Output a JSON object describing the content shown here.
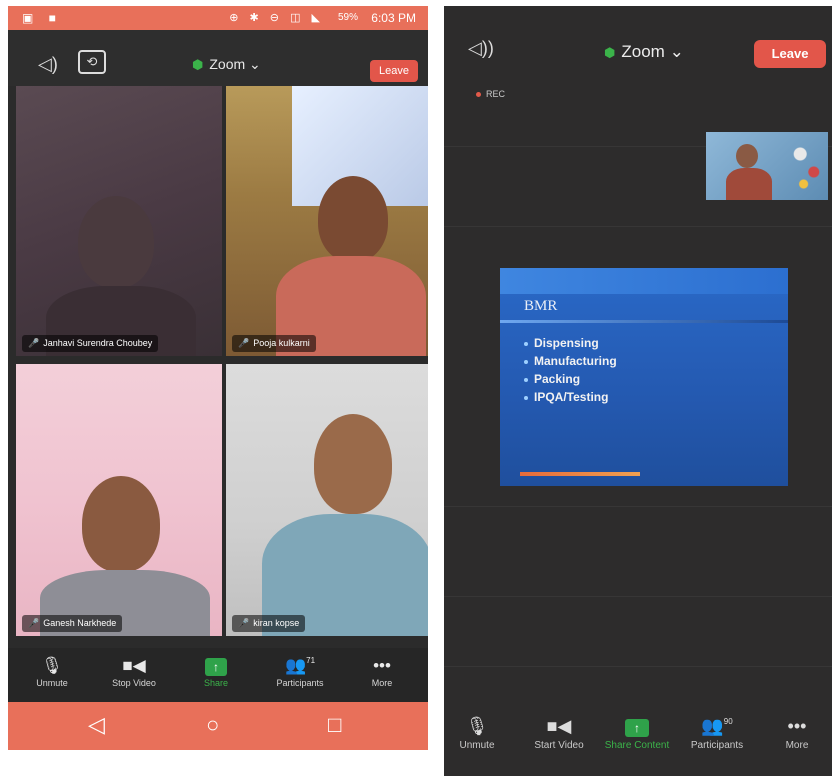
{
  "left_phone": {
    "status_bar": {
      "left_icons": "▣ ■",
      "right_icons": "⊕ ✱ ⊖ ◫ ◣",
      "battery": "59%",
      "time": "6:03 PM"
    },
    "header": {
      "title": "Zoom",
      "chevron": "⌄",
      "leave_label": "Leave"
    },
    "participants": [
      {
        "name": "Janhavi Surendra Choubey"
      },
      {
        "name": "Pooja kulkarni"
      },
      {
        "name": "Ganesh Narkhede"
      },
      {
        "name": "kiran kopse"
      }
    ],
    "toolbar": {
      "unmute": "Unmute",
      "stop_video": "Stop Video",
      "share": "Share",
      "participants": "Participants",
      "participants_count": "71",
      "more": "More"
    },
    "nav": {
      "back": "◁",
      "home": "○",
      "recents": "□"
    }
  },
  "right_phone": {
    "header": {
      "title": "Zoom",
      "chevron": "⌄",
      "leave_label": "Leave"
    },
    "rec_label": "REC",
    "slide": {
      "title": "BMR",
      "bullets": [
        "Dispensing",
        "Manufacturing",
        "Packing",
        "IPQA/Testing"
      ]
    },
    "toolbar": {
      "unmute": "Unmute",
      "start_video": "Start Video",
      "share_content": "Share Content",
      "participants": "Participants",
      "participants_count": "90",
      "more": "More"
    }
  },
  "colors": {
    "status_bar": "#e8705a",
    "leave_button": "#e2564a",
    "share_green": "#2fa24a",
    "background_dark": "#2d2c2c"
  },
  "icons": {
    "speaker": "speaker-icon",
    "camera_flip": "camera-flip-icon",
    "shield": "shield-icon",
    "mic_muted": "mic-muted-icon",
    "video": "video-icon",
    "share": "share-icon",
    "participants": "participants-icon",
    "more": "more-icon"
  }
}
